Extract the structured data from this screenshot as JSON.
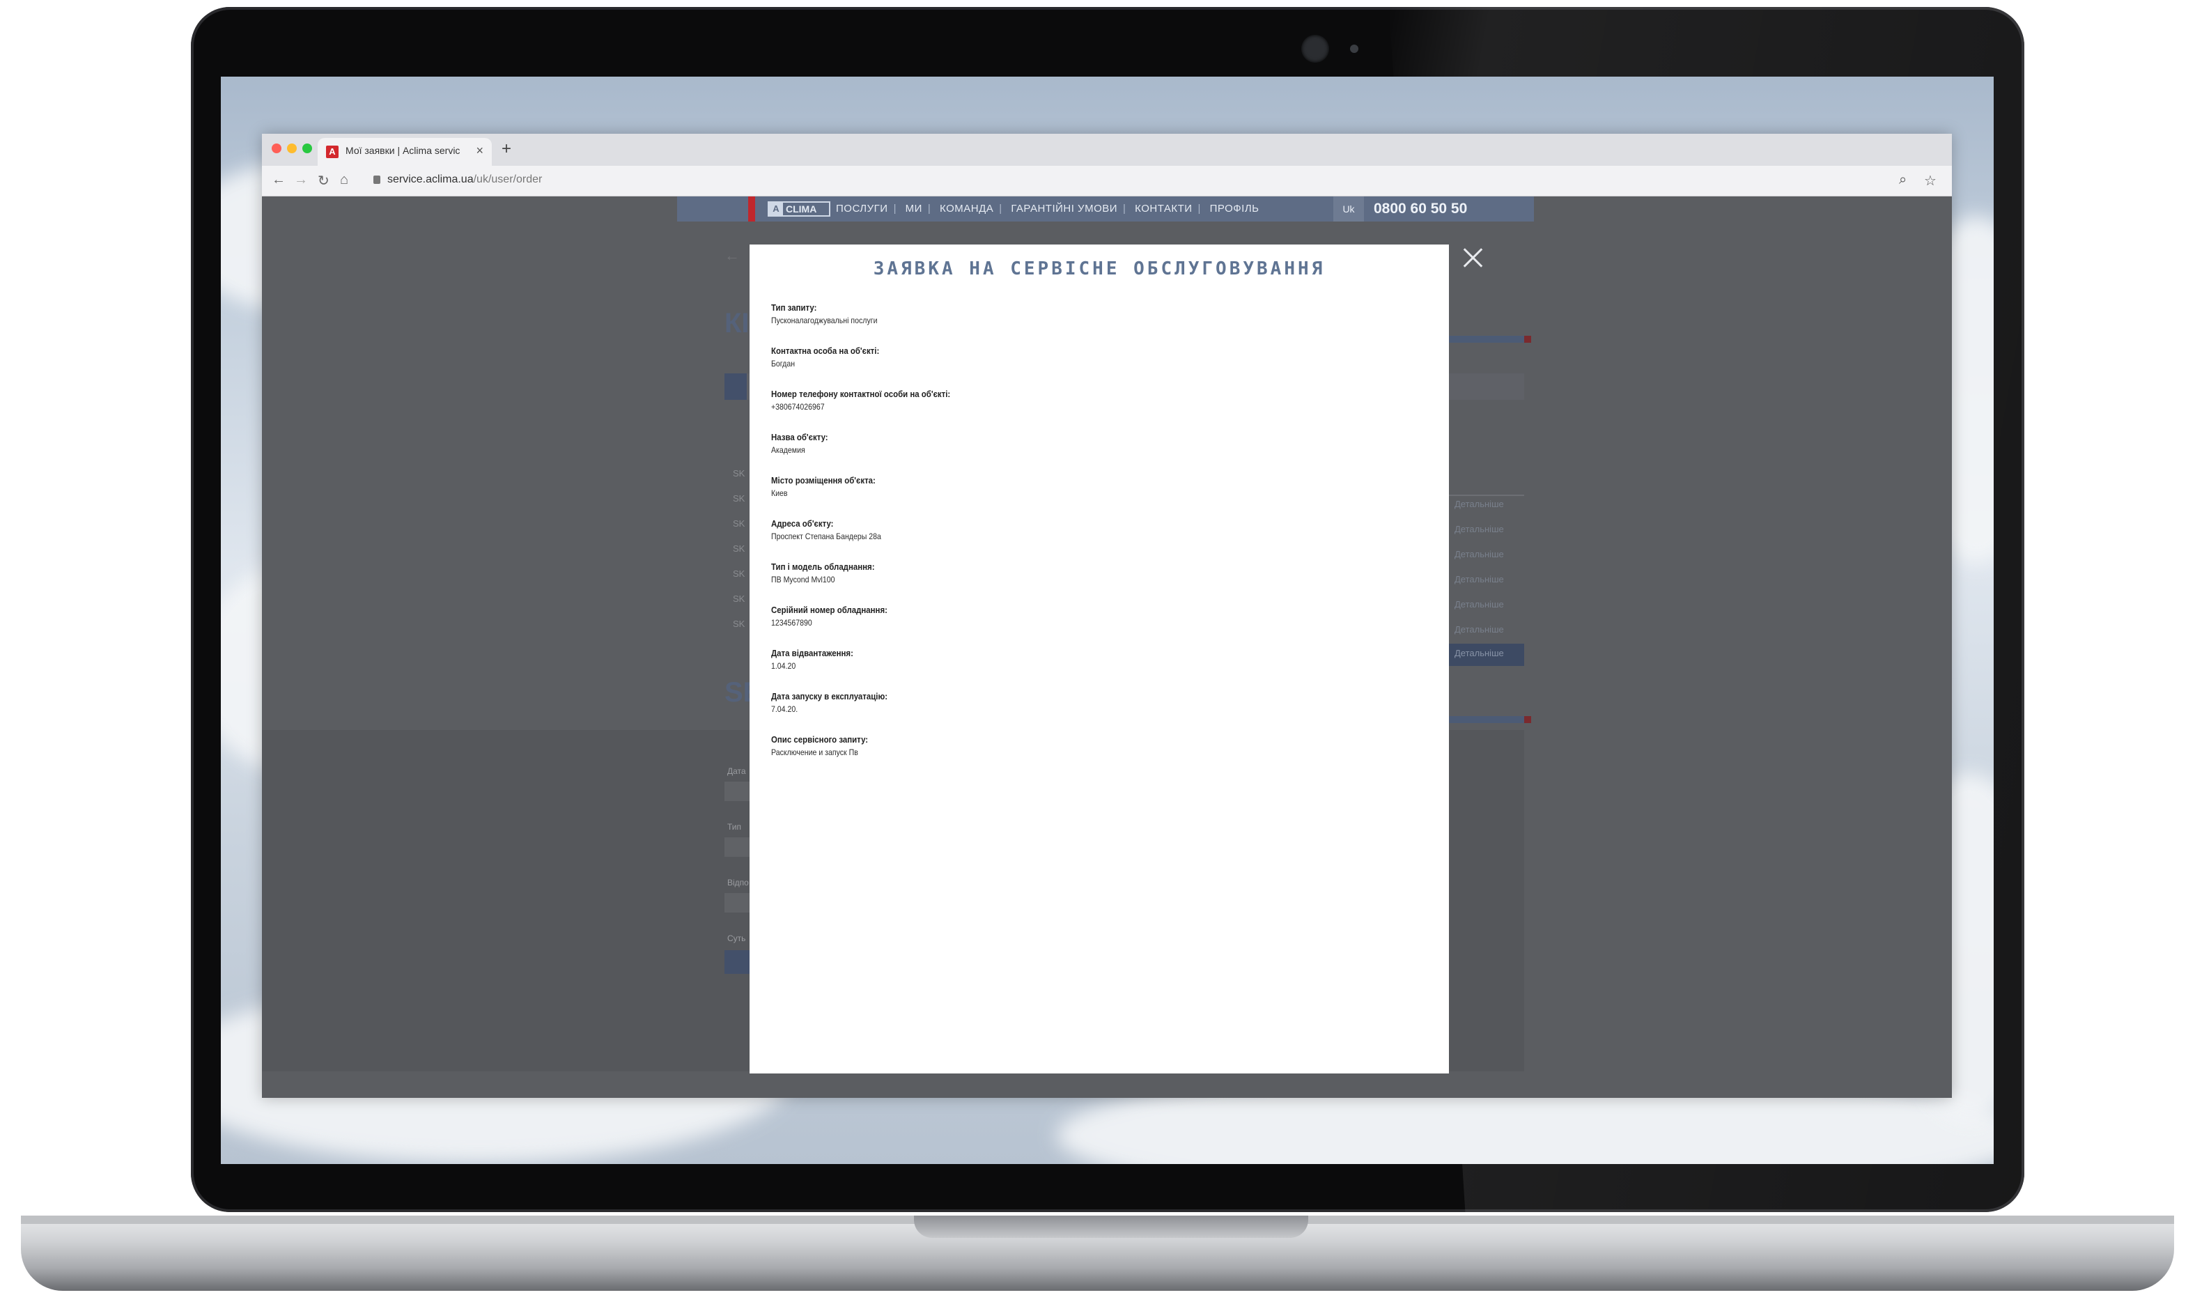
{
  "browser": {
    "tab_title": "Мої заявки | Aclima servic",
    "favicon_letter": "A",
    "url_host": "service.aclima.ua",
    "url_path": "/uk/user/order"
  },
  "site": {
    "logo_mark": "A",
    "logo_text": "CLIMA",
    "menu": [
      "ПОСЛУГИ",
      "МИ",
      "КОМАНДА",
      "ГАРАНТІЙНІ УМОВИ",
      "КОНТАКТИ",
      "ПРОФІЛЬ"
    ],
    "lang": "Uk",
    "phone": "0800 60 50 50",
    "colors": {
      "nav": "#5e6c85",
      "accent_red": "#c0272d",
      "title_blue": "#5f7493"
    }
  },
  "modal": {
    "title": "ЗАЯВКА НА СЕРВІСНЕ ОБСЛУГОВУВАННЯ",
    "fields": [
      {
        "label": "Тип запиту:",
        "value": "Пусконалагоджувальні послуги"
      },
      {
        "label": "Контактна особа на об'єкті:",
        "value": "Богдан"
      },
      {
        "label": "Номер телефону контактної особи на об'єкті:",
        "value": "+380674026967"
      },
      {
        "label": "Назва об'єкту:",
        "value": "Академия"
      },
      {
        "label": "Місто розміщення об'єкта:",
        "value": "Киев"
      },
      {
        "label": "Адреса об'єкту:",
        "value": "Проспект Степана Бандеры 28а"
      },
      {
        "label": "Тип і модель обладнання:",
        "value": "ПВ Mycond Mvl100"
      },
      {
        "label": "Серійний номер обладнання:",
        "value": "1234567890"
      },
      {
        "label": "Дата відвантаження:",
        "value": "1.04.20"
      },
      {
        "label": "Дата запуску в експлуатацію:",
        "value": "7.04.20."
      },
      {
        "label": "Опис сервісного запиту:",
        "value": "Расключение и запуск Пв"
      }
    ]
  },
  "background_page": {
    "row_prefix": "SK",
    "detail_link": "Детальніше",
    "heading_fragment_1": "КІ",
    "heading_fragment_2": "SE",
    "form_label_date": "Дата",
    "form_label_type": "Тип",
    "form_label_resp": "Відпо",
    "form_label_essence": "Суть"
  }
}
